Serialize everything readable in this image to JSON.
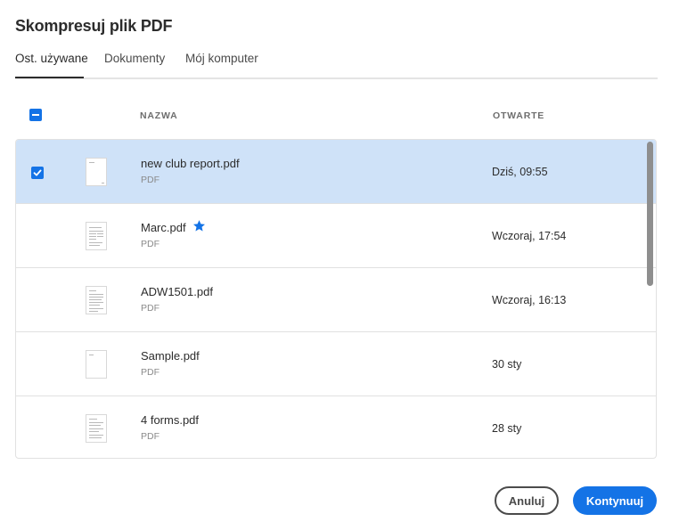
{
  "dialog": {
    "title": "Skompresuj plik PDF"
  },
  "tabs": [
    {
      "label": "Ost. używane",
      "active": true
    },
    {
      "label": "Dokumenty",
      "active": false
    },
    {
      "label": "Mój komputer",
      "active": false
    }
  ],
  "table": {
    "columns": {
      "name": "NAZWA",
      "opened": "OTWARTE"
    },
    "rows": [
      {
        "name": "new club report.pdf",
        "type": "PDF",
        "opened": "Dziś, 09:55",
        "selected": true,
        "starred": false
      },
      {
        "name": "Marc.pdf",
        "type": "PDF",
        "opened": "Wczoraj, 17:54",
        "selected": false,
        "starred": true
      },
      {
        "name": "ADW1501.pdf",
        "type": "PDF",
        "opened": "Wczoraj, 16:13",
        "selected": false,
        "starred": false
      },
      {
        "name": "Sample.pdf",
        "type": "PDF",
        "opened": "30 sty",
        "selected": false,
        "starred": false
      },
      {
        "name": "4 forms.pdf",
        "type": "PDF",
        "opened": "28 sty",
        "selected": false,
        "starred": false
      }
    ]
  },
  "buttons": {
    "cancel": "Anuluj",
    "continue": "Kontynuuj"
  },
  "colors": {
    "accent": "#1473e6",
    "selected_row": "#cfe2f8"
  },
  "icons": {
    "header_checkbox": "checkbox-indeterminate-icon",
    "row_checkbox": "checkbox-checked-icon",
    "favorite": "star-icon",
    "file": "pdf-thumbnail-icon"
  }
}
